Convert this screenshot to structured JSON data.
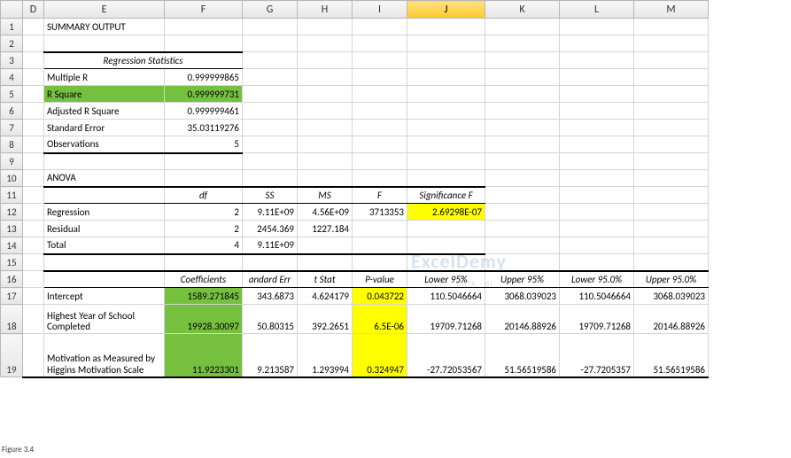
{
  "cols": [
    "D",
    "E",
    "F",
    "G",
    "H",
    "I",
    "J",
    "K",
    "L",
    "M"
  ],
  "rows": [
    "1",
    "2",
    "3",
    "4",
    "5",
    "6",
    "7",
    "8",
    "9",
    "10",
    "11",
    "12",
    "13",
    "14",
    "15",
    "16",
    "17",
    "18",
    "19"
  ],
  "summary": {
    "title": "SUMMARY OUTPUT",
    "regstats_header": "Regression Statistics",
    "stats": [
      {
        "label": "Multiple R",
        "val": "0.999999865"
      },
      {
        "label": "R Square",
        "val": "0.999999731"
      },
      {
        "label": "Adjusted R Square",
        "val": "0.999999461"
      },
      {
        "label": "Standard Error",
        "val": "35.03119276"
      },
      {
        "label": "Observations",
        "val": "5"
      }
    ]
  },
  "anova": {
    "title": "ANOVA",
    "headers": [
      "df",
      "SS",
      "MS",
      "F",
      "Significance F"
    ],
    "rows": [
      {
        "label": "Regression",
        "df": "2",
        "ss": "9.11E+09",
        "ms": "4.56E+09",
        "f": "3713353",
        "sig": "2.69298E-07"
      },
      {
        "label": "Residual",
        "df": "2",
        "ss": "2454.369",
        "ms": "1227.184"
      },
      {
        "label": "Total",
        "df": "4",
        "ss": "9.11E+09"
      }
    ]
  },
  "coef": {
    "headers": [
      "Coefficients",
      "andard Err",
      "t Stat",
      "P-value",
      "Lower 95%",
      "Upper 95%",
      "Lower 95.0%",
      "Upper 95.0%"
    ],
    "rows": [
      {
        "label": "Intercept",
        "coef": "1589.271845",
        "se": "343.6873",
        "t": "4.624179",
        "p": "0.043722",
        "l95": "110.5046664",
        "u95": "3068.039023",
        "l95b": "110.5046664",
        "u95b": "3068.039023"
      },
      {
        "label": "Highest Year of School Completed",
        "coef": "19928.30097",
        "se": "50.80315",
        "t": "392.2651",
        "p": "6.5E-06",
        "l95": "19709.71268",
        "u95": "20146.88926",
        "l95b": "19709.71268",
        "u95b": "20146.88926"
      },
      {
        "label": "Motivation as Measured by Higgins Motivation Scale",
        "coef": "11.9223301",
        "se": "9.213587",
        "t": "1.293994",
        "p": "0.324947",
        "l95": "-27.72053567",
        "u95": "51.56519586",
        "l95b": "-27.7205357",
        "u95b": "51.56519586"
      }
    ]
  },
  "figure": "Figure 3.4",
  "watermark": {
    "brand": "ExcelDemy",
    "sub": "EXCEL · DATA · BI"
  }
}
